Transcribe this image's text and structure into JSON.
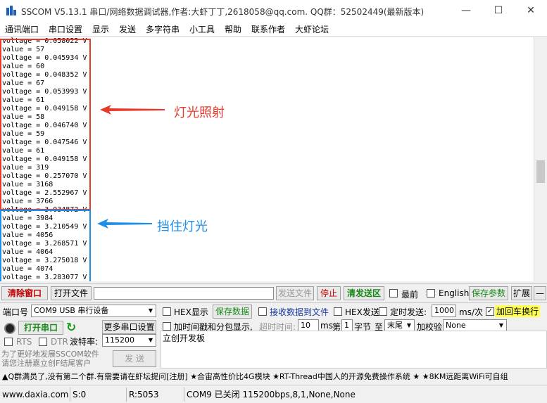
{
  "window": {
    "title": "SSCOM V5.13.1 串口/网络数据调试器,作者:大虾丁丁,2618058@qq.com. QQ群：52502449(最新版本)"
  },
  "menu": [
    "通讯端口",
    "串口设置",
    "显示",
    "发送",
    "多字符串",
    "小工具",
    "帮助",
    "联系作者",
    "大虾论坛"
  ],
  "terminal": {
    "lines": [
      "voltage = 0.058022 V",
      "value = 57",
      "voltage = 0.045934 V",
      "value = 60",
      "voltage = 0.048352 V",
      "value = 67",
      "voltage = 0.053993 V",
      "value = 61",
      "voltage = 0.049158 V",
      "value = 58",
      "voltage = 0.046740 V",
      "value = 59",
      "voltage = 0.047546 V",
      "value = 61",
      "voltage = 0.049158 V",
      "value = 319",
      "voltage = 0.257070 V",
      "value = 3168",
      "voltage = 2.552967 V",
      "value = 3766",
      "voltage = 3.034872 V",
      "value = 3984",
      "voltage = 3.210549 V",
      "value = 4056",
      "voltage = 3.268571 V",
      "value = 4064",
      "voltage = 3.275018 V",
      "value = 4074",
      "voltage = 3.283077 V"
    ]
  },
  "annotations": {
    "light_on": "灯光照射",
    "light_blocked": "挡住灯光",
    "red": "#e83a2a",
    "blue": "#1e8fe8"
  },
  "toolbar": {
    "clear_window": "清除窗口",
    "open_file": "打开文件",
    "send_file": "发送文件",
    "stop": "停止",
    "clear_send": "清发送区",
    "topmost": "最前",
    "english": "English",
    "save_params": "保存参数",
    "expand": "扩展",
    "collapse": "—"
  },
  "port": {
    "port_label": "端口号",
    "port_value": "COM9 USB 串行设备",
    "open_port": "打开串口",
    "more_settings": "更多串口设置",
    "rts": "RTS",
    "dtr": "DTR",
    "baud_label": "波特率:",
    "baud_value": "115200",
    "promo": "为了更好地发展SSCOM软件\n请您注册嘉立创F结尾客户",
    "send": "发 送"
  },
  "options": {
    "hex_display": "HEX显示",
    "save_data": "保存数据",
    "recv_to_file": "接收数据到文件",
    "hex_send": "HEX发送",
    "timed_send": "定时发送:",
    "interval": "1000",
    "interval_unit": "ms/次",
    "add_crlf": "加回车换行",
    "timestamp": "加时间戳和分包显示,",
    "timeout_label": "超时时间:",
    "timeout_value": "10",
    "timeout_unit": "ms",
    "nth_label": "第",
    "nth_value": "1",
    "byte_label": "字节",
    "to_label": "至",
    "to_value": "末尾",
    "checksum_label": "加校验",
    "checksum_value": "None"
  },
  "send_area": {
    "text": "立创开发板"
  },
  "ticker": "▲Q群满员了,没有第二个群.有需要请在虾坛提问[注册] ★合宙高性价比4G模块 ★RT-Thread中国人的开源免费操作系统 ★ ★8KM远距离WiFi可自组",
  "status": {
    "website": "www.daxia.com",
    "sent": "S:0",
    "received": "R:5053",
    "port_state": "COM9 已关闭  115200bps,8,1,None,None"
  }
}
